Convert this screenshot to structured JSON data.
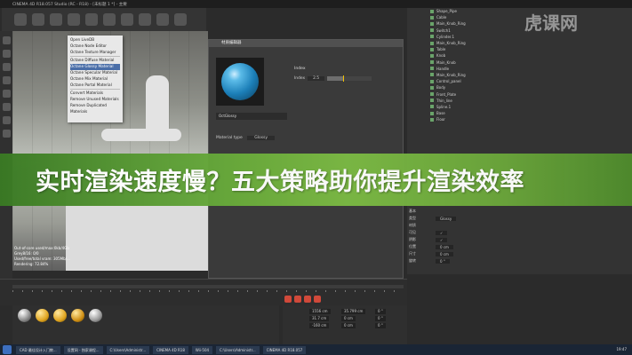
{
  "window": {
    "title": "CINEMA 4D R18.057 Studio (RC - R18) - [未标题 1 *] - 主要"
  },
  "banner": {
    "headline": "实时渲染速度慢？五大策略助你提升渲染效率"
  },
  "watermark": {
    "text": "虎课网"
  },
  "context_menu": {
    "items": [
      "Open LiveDB",
      "Octane Node Editor",
      "Octane Texture Manager",
      "Octane Diffuse Material",
      "Octane Glossy Material",
      "Octane Specular Material",
      "Octane Mix Material",
      "Octane Portal Material",
      "Convert Materials",
      "Remove Unused Materials",
      "Remove Duplicated Materials"
    ],
    "highlighted_index": 4
  },
  "viewport": {
    "stats": [
      "Out-of-core used/max:0kb/4Gb",
      "Grey8/16: 0/0",
      "Used/free/total vram: 305Mb/...",
      "Rendering: 72.84%"
    ]
  },
  "material_editor": {
    "title": "材质编辑器",
    "material_name": "OctGlossy",
    "material_type_label": "Material type",
    "material_type_value": "Glossy",
    "section_label": "Index",
    "index_label": "Index",
    "index_value": "2.5"
  },
  "object_manager": {
    "objects": [
      "Shape_Pipe",
      "Cable",
      "Main_Knob_Ring",
      "Switch1",
      "Cylinder.1",
      "Main_Knob_Ring",
      "Table",
      "Knob",
      "Main_Knob",
      "Handle",
      "Main_Knob_Ring",
      "Control_panel",
      "Body",
      "Front_Plate",
      "Thin_line",
      "Spline.1",
      "Base",
      "Floor"
    ]
  },
  "attributes": {
    "rows": [
      {
        "label": "基本",
        "value": ""
      },
      {
        "label": "类型",
        "value": "Glossy"
      },
      {
        "label": "材质",
        "value": ""
      },
      {
        "label": "可见",
        "value": "✓"
      },
      {
        "label": "阴影",
        "value": "✓"
      },
      {
        "label": "位置",
        "value": "0 cm"
      },
      {
        "label": "尺寸",
        "value": "0 cm"
      },
      {
        "label": "旋转",
        "value": "0 °"
      }
    ]
  },
  "coordinates": {
    "values": [
      "1556 cm",
      "31.7 cm",
      "-160 cm",
      "35.799 cm",
      "0 cm",
      "0 cm",
      "0 °",
      "0 °",
      "0 °"
    ]
  },
  "taskbar": {
    "items": [
      "CAD 最佳设计入门教...",
      "设置网 - 独家课程...",
      "C:\\Users\\Administr...",
      "CINEMA 4D R18",
      "Wii-504",
      "C:\\Users\\Administr...",
      "CINEMA 4D R18.057"
    ],
    "clock": "19:47"
  },
  "colors": {
    "banner_green": "#67a93a",
    "accent_red": "#d0493a",
    "ball_blue": "#1c7fb8"
  }
}
